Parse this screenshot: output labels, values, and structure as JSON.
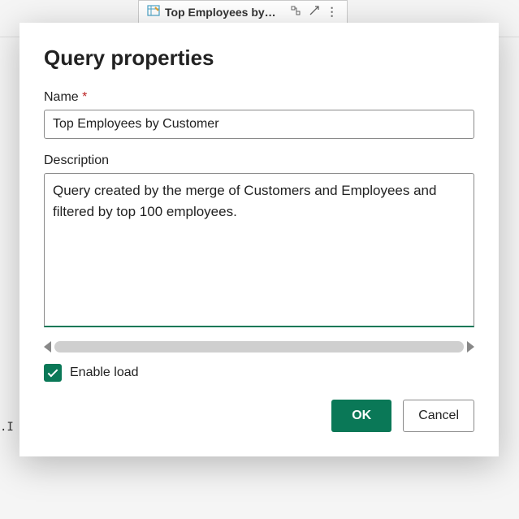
{
  "background": {
    "tab_title": "Top Employees by…",
    "snippet": ".I"
  },
  "dialog": {
    "title": "Query properties",
    "name_label": "Name",
    "required_marker": "*",
    "name_value": "Top Employees by Customer",
    "description_label": "Description",
    "description_value": "Query created by the merge of Customers and Employees and filtered by top 100 employees.",
    "enable_load_label": "Enable load",
    "enable_load_checked": true,
    "ok_label": "OK",
    "cancel_label": "Cancel"
  }
}
